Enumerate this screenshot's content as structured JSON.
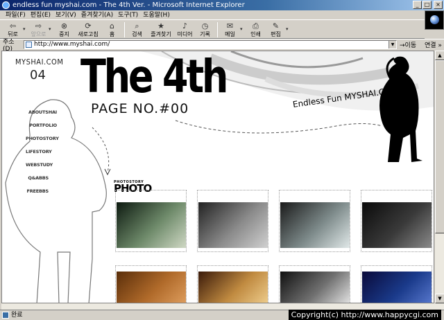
{
  "window": {
    "title": "endless fun myshai.com - The 4th Ver. - Microsoft Internet Explorer",
    "buttons": [
      "_",
      "□",
      "×"
    ]
  },
  "menu": {
    "items": [
      "파일(F)",
      "편집(E)",
      "보기(V)",
      "즐겨찾기(A)",
      "도구(T)",
      "도움말(H)"
    ]
  },
  "toolbar": {
    "buttons": [
      {
        "label": "뒤로",
        "icon": "back-arrow-icon",
        "glyph": "⇦"
      },
      {
        "label": "앞으로",
        "icon": "forward-arrow-icon",
        "glyph": "⇨"
      },
      {
        "label": "중지",
        "icon": "stop-icon",
        "glyph": "⊗"
      },
      {
        "label": "새로고침",
        "icon": "refresh-icon",
        "glyph": "⟳"
      },
      {
        "label": "홈",
        "icon": "home-icon",
        "glyph": "⌂"
      },
      {
        "label": "검색",
        "icon": "search-icon",
        "glyph": "⌕"
      },
      {
        "label": "즐겨찾기",
        "icon": "favorites-icon",
        "glyph": "★"
      },
      {
        "label": "미디어",
        "icon": "media-icon",
        "glyph": "♪"
      },
      {
        "label": "기록",
        "icon": "history-icon",
        "glyph": "◷"
      },
      {
        "label": "메일",
        "icon": "mail-icon",
        "glyph": "✉"
      },
      {
        "label": "인쇄",
        "icon": "print-icon",
        "glyph": "⎙"
      },
      {
        "label": "편집",
        "icon": "edit-icon",
        "glyph": "✎"
      }
    ]
  },
  "address": {
    "label": "주소(D)",
    "url": "http://www.myshai.com/",
    "go_label": "이동",
    "links_label": "연결"
  },
  "page": {
    "site_name": "MYSHAI.COM",
    "issue": "04",
    "title": "The 4th",
    "page_no": "PAGE NO.#00",
    "slogan": "Endless Fun MYSHAI.COM",
    "nav": [
      {
        "prefix": "ABOUT",
        "suffix": "SHAI"
      },
      {
        "prefix": "PORT",
        "suffix": "FOLIO"
      },
      {
        "prefix": "PHOTO",
        "suffix": "STORY"
      },
      {
        "prefix": "LIFE",
        "suffix": "STORY"
      },
      {
        "prefix": "WEB",
        "suffix": "STUDY"
      },
      {
        "prefix": "Q&A",
        "suffix": "BBS"
      },
      {
        "prefix": "FREE",
        "suffix": "BBS"
      }
    ],
    "section_small": "PHOTOSTORY",
    "section_large": "PHOTO",
    "photos": [
      {
        "colors": [
          "#0d1a10",
          "#6e8a6a",
          "#cfd8c4"
        ]
      },
      {
        "colors": [
          "#222222",
          "#8a8a8a",
          "#d0d0d0"
        ]
      },
      {
        "colors": [
          "#1a1a1a",
          "#7d8a8a",
          "#e0e8e8"
        ]
      },
      {
        "colors": [
          "#0a0a0a",
          "#3a3a3a",
          "#8a8a8a"
        ]
      },
      {
        "colors": [
          "#5a2e0a",
          "#b06a2a",
          "#e0a060"
        ]
      },
      {
        "colors": [
          "#3a1a0a",
          "#c08a40",
          "#f0d090"
        ]
      },
      {
        "colors": [
          "#101010",
          "#707070",
          "#e8e8e8"
        ]
      },
      {
        "colors": [
          "#0a0a3a",
          "#1a3a8a",
          "#5a7ad0"
        ]
      }
    ]
  },
  "status": {
    "text": "완료",
    "watermark": "Copyright(c) http://www.happycgi.com"
  }
}
